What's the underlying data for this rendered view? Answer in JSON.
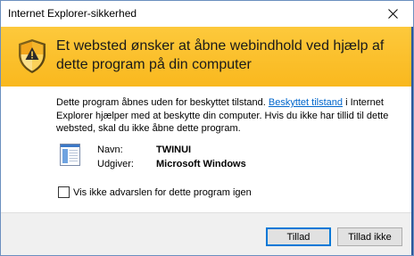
{
  "window": {
    "title": "Internet Explorer-sikkerhed"
  },
  "banner": {
    "headline": "Et websted ønsker at åbne webindhold ved hjælp af dette program på din computer"
  },
  "body": {
    "text_before_link": "Dette program åbnes uden for beskyttet tilstand. ",
    "link_text": "Beskyttet tilstand",
    "text_after_link": " i Internet Explorer hjælper med at beskytte din computer. Hvis du ikke har tillid til dette websted, skal du ikke åbne dette program."
  },
  "program": {
    "name_label": "Navn:",
    "name_value": "TWINUI",
    "publisher_label": "Udgiver:",
    "publisher_value": "Microsoft Windows"
  },
  "checkbox": {
    "label": "Vis ikke advarslen for dette program igen",
    "checked": false
  },
  "buttons": {
    "allow": "Tillad",
    "deny": "Tillad ikke"
  },
  "colors": {
    "banner": "#fcc331",
    "link": "#0066cc",
    "default_button_border": "#0078d7"
  },
  "icons": {
    "banner": "security-shield-icon",
    "program": "program-window-icon",
    "close": "close-icon"
  }
}
